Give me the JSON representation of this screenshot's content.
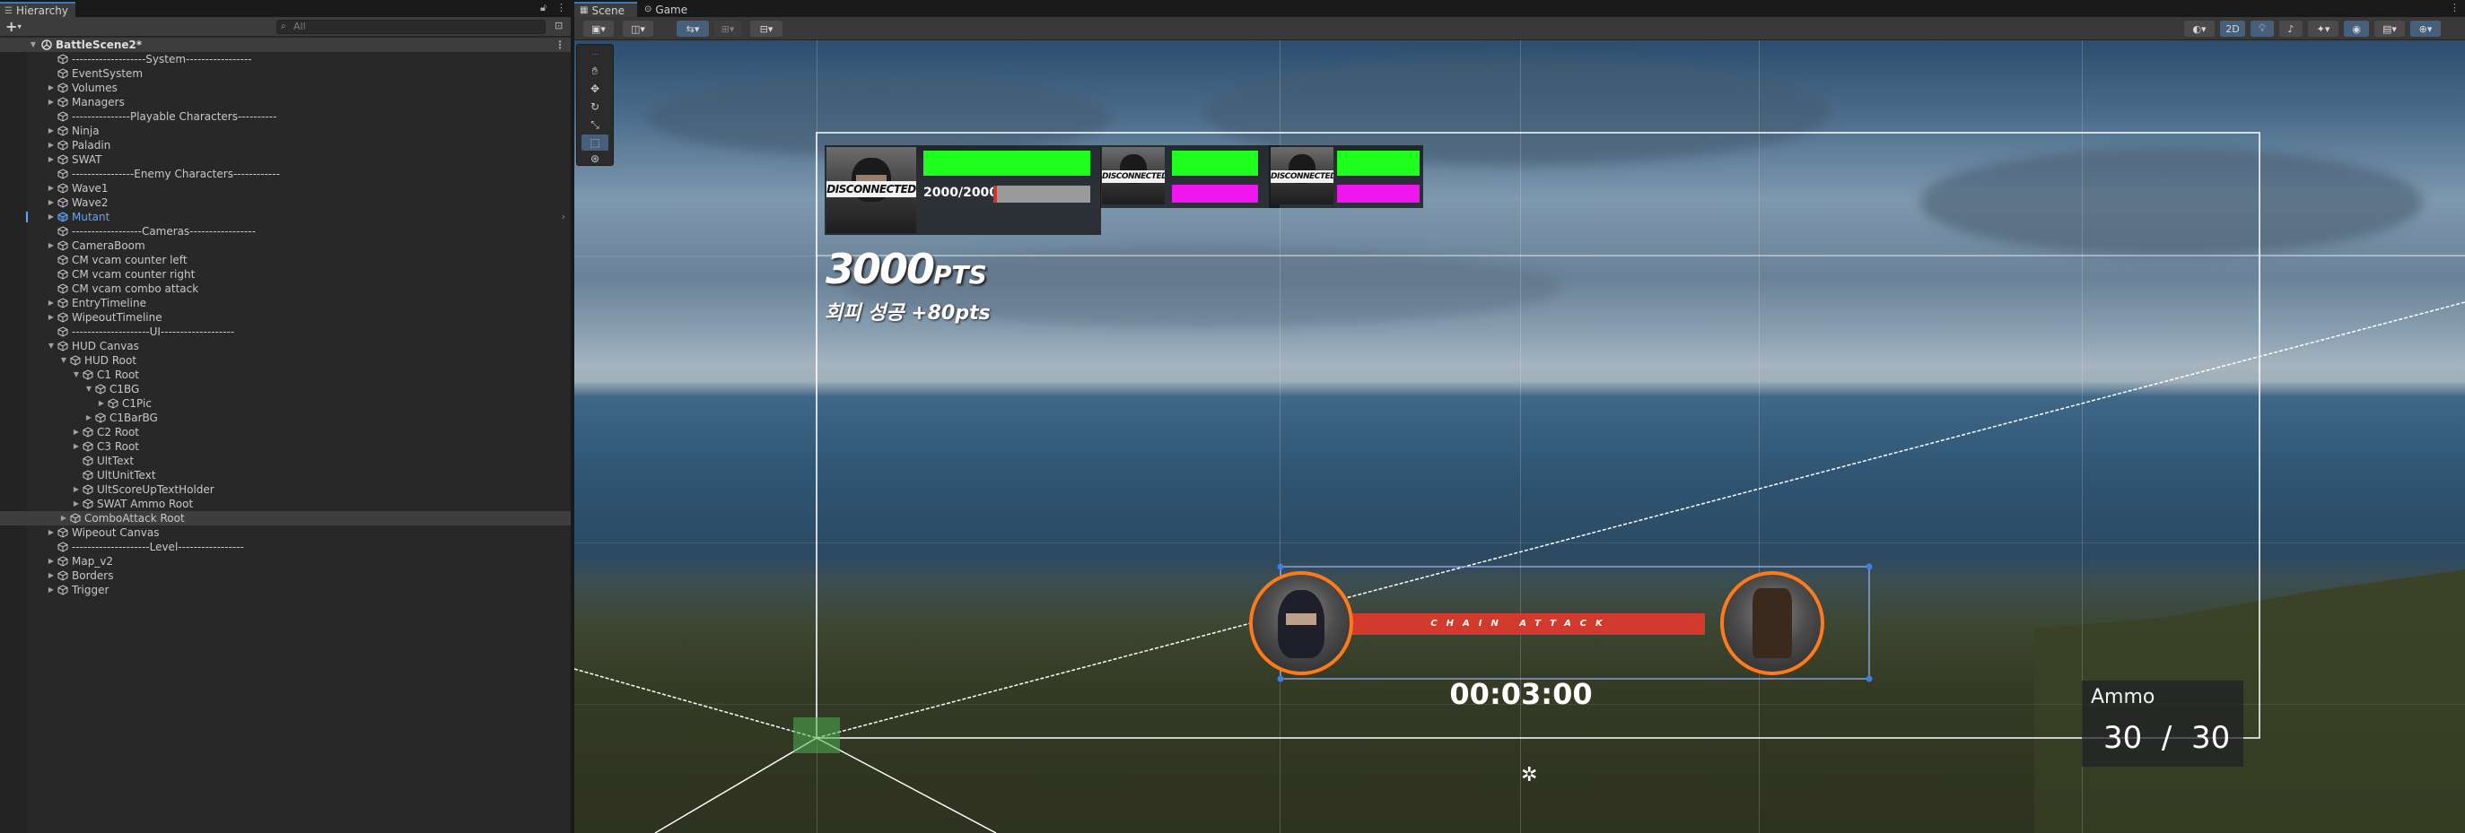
{
  "hierarchy": {
    "tab_title": "Hierarchy",
    "search_placeholder": "All",
    "add_button": "+",
    "scene_name": "BattleScene2*",
    "items": [
      {
        "label": "-------------------System-----------------",
        "depth": 1,
        "arrow": ""
      },
      {
        "label": "EventSystem",
        "depth": 1,
        "arrow": ""
      },
      {
        "label": "Volumes",
        "depth": 1,
        "arrow": "right"
      },
      {
        "label": "Managers",
        "depth": 1,
        "arrow": "right"
      },
      {
        "label": "---------------Playable Characters----------",
        "depth": 1,
        "arrow": ""
      },
      {
        "label": "Ninja",
        "depth": 1,
        "arrow": "right"
      },
      {
        "label": "Paladin",
        "depth": 1,
        "arrow": "right"
      },
      {
        "label": "SWAT",
        "depth": 1,
        "arrow": "right"
      },
      {
        "label": "----------------Enemy Characters------------",
        "depth": 1,
        "arrow": ""
      },
      {
        "label": "Wave1",
        "depth": 1,
        "arrow": "right"
      },
      {
        "label": "Wave2",
        "depth": 1,
        "arrow": "right"
      },
      {
        "label": "Mutant",
        "depth": 1,
        "arrow": "right",
        "prefab": true
      },
      {
        "label": "------------------Cameras-----------------",
        "depth": 1,
        "arrow": ""
      },
      {
        "label": "CameraBoom",
        "depth": 1,
        "arrow": "right"
      },
      {
        "label": "CM vcam counter left",
        "depth": 1,
        "arrow": ""
      },
      {
        "label": "CM vcam counter right",
        "depth": 1,
        "arrow": ""
      },
      {
        "label": "CM vcam combo attack",
        "depth": 1,
        "arrow": ""
      },
      {
        "label": "EntryTimeline",
        "depth": 1,
        "arrow": "right"
      },
      {
        "label": "WipeoutTimeline",
        "depth": 1,
        "arrow": "right"
      },
      {
        "label": "--------------------UI-------------------",
        "depth": 1,
        "arrow": ""
      },
      {
        "label": "HUD Canvas",
        "depth": 1,
        "arrow": "down"
      },
      {
        "label": "HUD Root",
        "depth": 2,
        "arrow": "down"
      },
      {
        "label": "C1 Root",
        "depth": 3,
        "arrow": "down"
      },
      {
        "label": "C1BG",
        "depth": 4,
        "arrow": "down"
      },
      {
        "label": "C1Pic",
        "depth": 5,
        "arrow": "right"
      },
      {
        "label": "C1BarBG",
        "depth": 4,
        "arrow": "right"
      },
      {
        "label": "C2 Root",
        "depth": 3,
        "arrow": "right"
      },
      {
        "label": "C3 Root",
        "depth": 3,
        "arrow": "right"
      },
      {
        "label": "UltText",
        "depth": 3,
        "arrow": ""
      },
      {
        "label": "UltUnitText",
        "depth": 3,
        "arrow": ""
      },
      {
        "label": "UltScoreUpTextHolder",
        "depth": 3,
        "arrow": "right"
      },
      {
        "label": "SWAT Ammo Root",
        "depth": 3,
        "arrow": "right"
      },
      {
        "label": "ComboAttack Root",
        "depth": 2,
        "arrow": "right",
        "selected": true
      },
      {
        "label": "Wipeout Canvas",
        "depth": 1,
        "arrow": "right"
      },
      {
        "label": "--------------------Level-----------------",
        "depth": 1,
        "arrow": ""
      },
      {
        "label": "Map_v2",
        "depth": 1,
        "arrow": "right"
      },
      {
        "label": "Borders",
        "depth": 1,
        "arrow": "right"
      },
      {
        "label": "Trigger",
        "depth": 1,
        "arrow": "right"
      }
    ]
  },
  "scene_view": {
    "tabs": [
      {
        "label": "Scene",
        "icon": "grid-icon",
        "active": true
      },
      {
        "label": "Game",
        "icon": "gamepad-icon",
        "active": false
      }
    ],
    "mode_2d": "2D",
    "tools": [
      "view-tool",
      "move-tool",
      "rotate-tool",
      "scale-tool",
      "rect-tool",
      "transform-tool"
    ]
  },
  "hud": {
    "disconnected_label": "DISCONNECTED",
    "hp_text": "2000/2000",
    "score": "3000",
    "score_unit": "PTS",
    "dodge_text": "회피 성공 +80pts",
    "chain_attack_label": "CHAIN ATTACK",
    "chain_timer": "00:03:00",
    "ammo_title": "Ammo",
    "ammo_value": "30  /  30",
    "colors": {
      "hp_bar": "#1eff1e",
      "ult_bar": "#ee15ee",
      "chain_bar": "#d13a2d",
      "portrait_ring": "#ff7a1a",
      "selection": "#3a79bb"
    }
  }
}
